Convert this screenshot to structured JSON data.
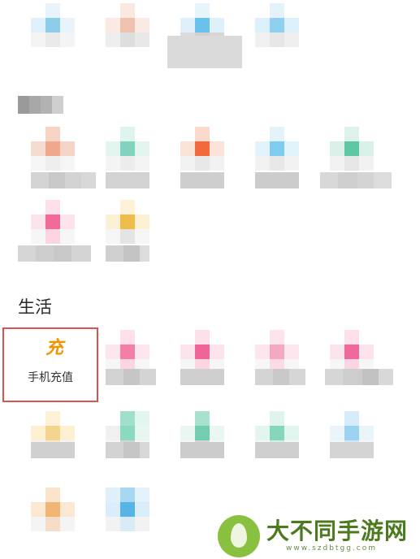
{
  "section_life": {
    "title": "生活"
  },
  "recharge_item": {
    "icon_char": "充",
    "label": "手机充值"
  },
  "watermark": {
    "brand": "大不同手游网",
    "url": "www.szdbtgg.com"
  },
  "colors": {
    "highlight_border": "#d9534f",
    "recharge_icon": "#f29300",
    "watermark_green": "#8ac03f"
  }
}
